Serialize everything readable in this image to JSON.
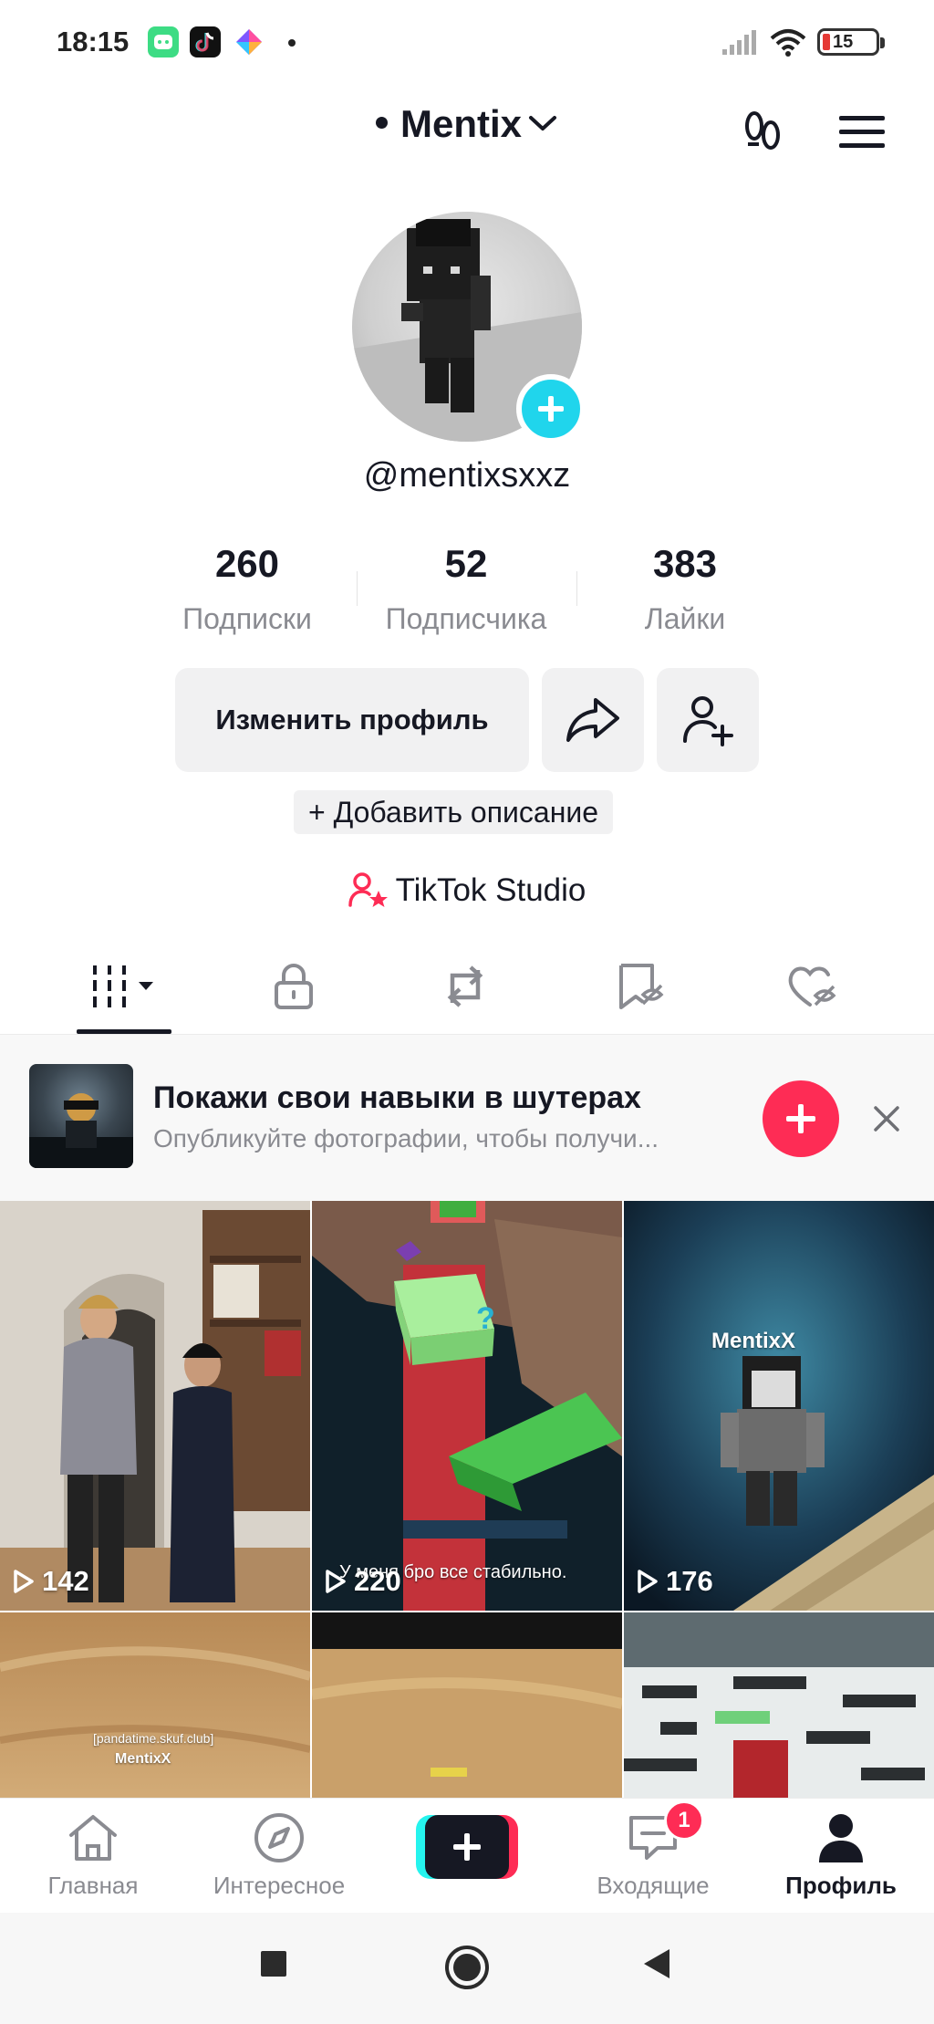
{
  "status_bar": {
    "time": "18:15",
    "battery": "15",
    "apps": [
      "android-app-icon",
      "tiktok-app-icon",
      "shortcut-app-icon"
    ]
  },
  "header": {
    "title": "Mentix",
    "icons": [
      "footprints-icon",
      "menu-icon"
    ]
  },
  "profile": {
    "username": "@mentixsxxz"
  },
  "stats": [
    {
      "value": "260",
      "label": "Подписки"
    },
    {
      "value": "52",
      "label": "Подписчика"
    },
    {
      "value": "383",
      "label": "Лайки"
    }
  ],
  "actions": {
    "edit_profile": "Изменить профиль",
    "add_bio": "+ Добавить описание",
    "studio": "TikTok Studio"
  },
  "tabs": [
    "videos-grid-icon",
    "private-lock-icon",
    "reposts-icon",
    "favorites-icon",
    "liked-icon"
  ],
  "banner": {
    "title": "Покажи свои навыки в шутерах",
    "subtitle": "Опубликуйте фотографии, чтобы получи..."
  },
  "videos": [
    {
      "views": "142"
    },
    {
      "views": "220",
      "caption": "У меня бро все стабильно."
    },
    {
      "views": "176",
      "watermark": "MentixX"
    },
    {
      "caption": "[pandatime.skuf.club]",
      "watermark": "MentixX"
    },
    {},
    {}
  ],
  "bottom_nav": {
    "home": "Главная",
    "discover": "Интересное",
    "inbox": "Входящие",
    "inbox_badge": "1",
    "profile": "Профиль"
  },
  "colors": {
    "accent": "#fe2c55",
    "cyan": "#20d5ec",
    "text": "#161823",
    "muted": "#8a8b91"
  }
}
